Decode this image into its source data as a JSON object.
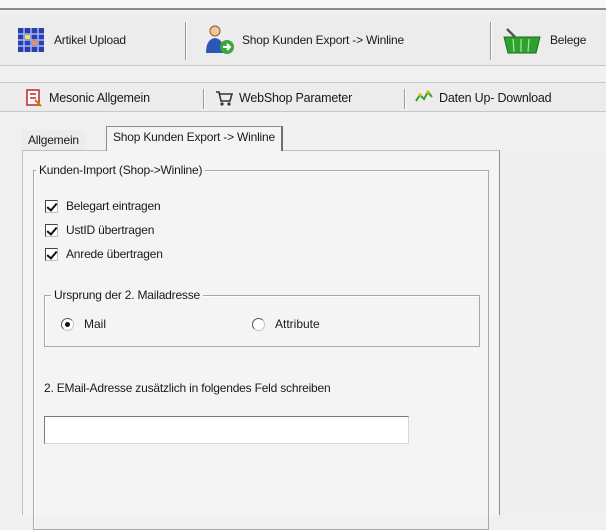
{
  "toolbar_main": {
    "items": [
      {
        "label": "Artikel Upload",
        "icon": "grid-upload-icon"
      },
      {
        "label": "Shop Kunden Export -> Winline",
        "icon": "user-export-icon"
      },
      {
        "label": "Belege",
        "icon": "basket-icon"
      }
    ]
  },
  "toolbar_sub": {
    "items": [
      {
        "label": "Mesonic Allgemein",
        "icon": "document-icon"
      },
      {
        "label": "WebShop Parameter",
        "icon": "cart-icon"
      },
      {
        "label": "Daten Up- Download",
        "icon": "data-transfer-icon"
      }
    ]
  },
  "tabs": [
    {
      "label": "Allgemein",
      "active": false
    },
    {
      "label": "Shop Kunden Export -> Winline",
      "active": true
    }
  ],
  "kunden_import": {
    "title": "Kunden-Import (Shop->Winline)",
    "checkboxes": [
      {
        "label": "Belegart eintragen",
        "checked": true
      },
      {
        "label": "UstID übertragen",
        "checked": true
      },
      {
        "label": "Anrede übertragen",
        "checked": true
      }
    ]
  },
  "ursprung": {
    "title": "Ursprung der 2. Mailadresse",
    "options": [
      {
        "label": "Mail",
        "selected": true
      },
      {
        "label": "Attribute",
        "selected": false
      }
    ]
  },
  "email_field": {
    "label": "2. EMail-Adresse zusätzlich in folgendes Feld schreiben",
    "value": ""
  }
}
